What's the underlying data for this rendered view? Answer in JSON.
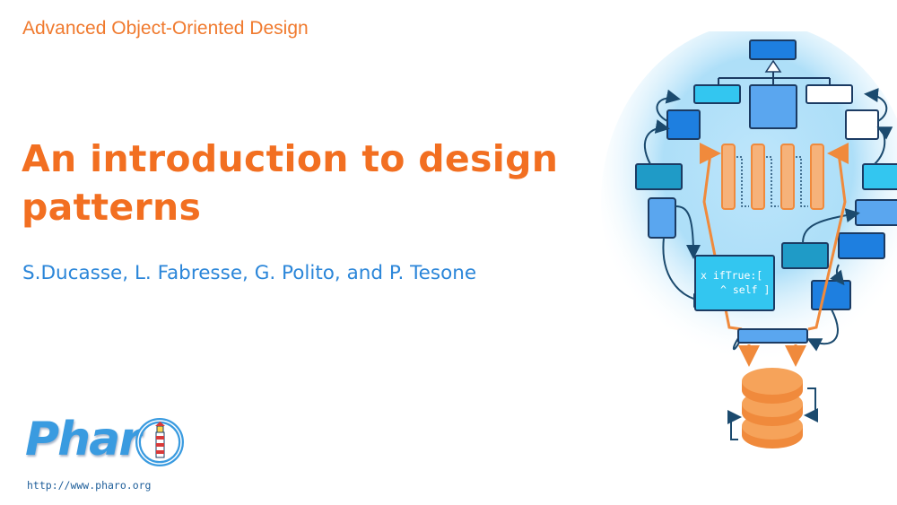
{
  "course_title": "Advanced Object-Oriented Design",
  "slide_title": "An introduction to design patterns",
  "authors": "S.Ducasse, L. Fabresse, G. Polito, and P. Tesone",
  "logo": {
    "wordmark": "Phar",
    "icon": "lighthouse-icon"
  },
  "url": "http://www.pharo.org",
  "illustration": {
    "code_line_1": "x ifTrue:[",
    "code_line_2": "^ self ]",
    "icon": "lightbulb-diagram-icon"
  },
  "colors": {
    "accent_orange": "#f26f21",
    "author_blue": "#2b86d9",
    "box_blue": "#1e7fe0",
    "box_cyan": "#33c6f0"
  }
}
